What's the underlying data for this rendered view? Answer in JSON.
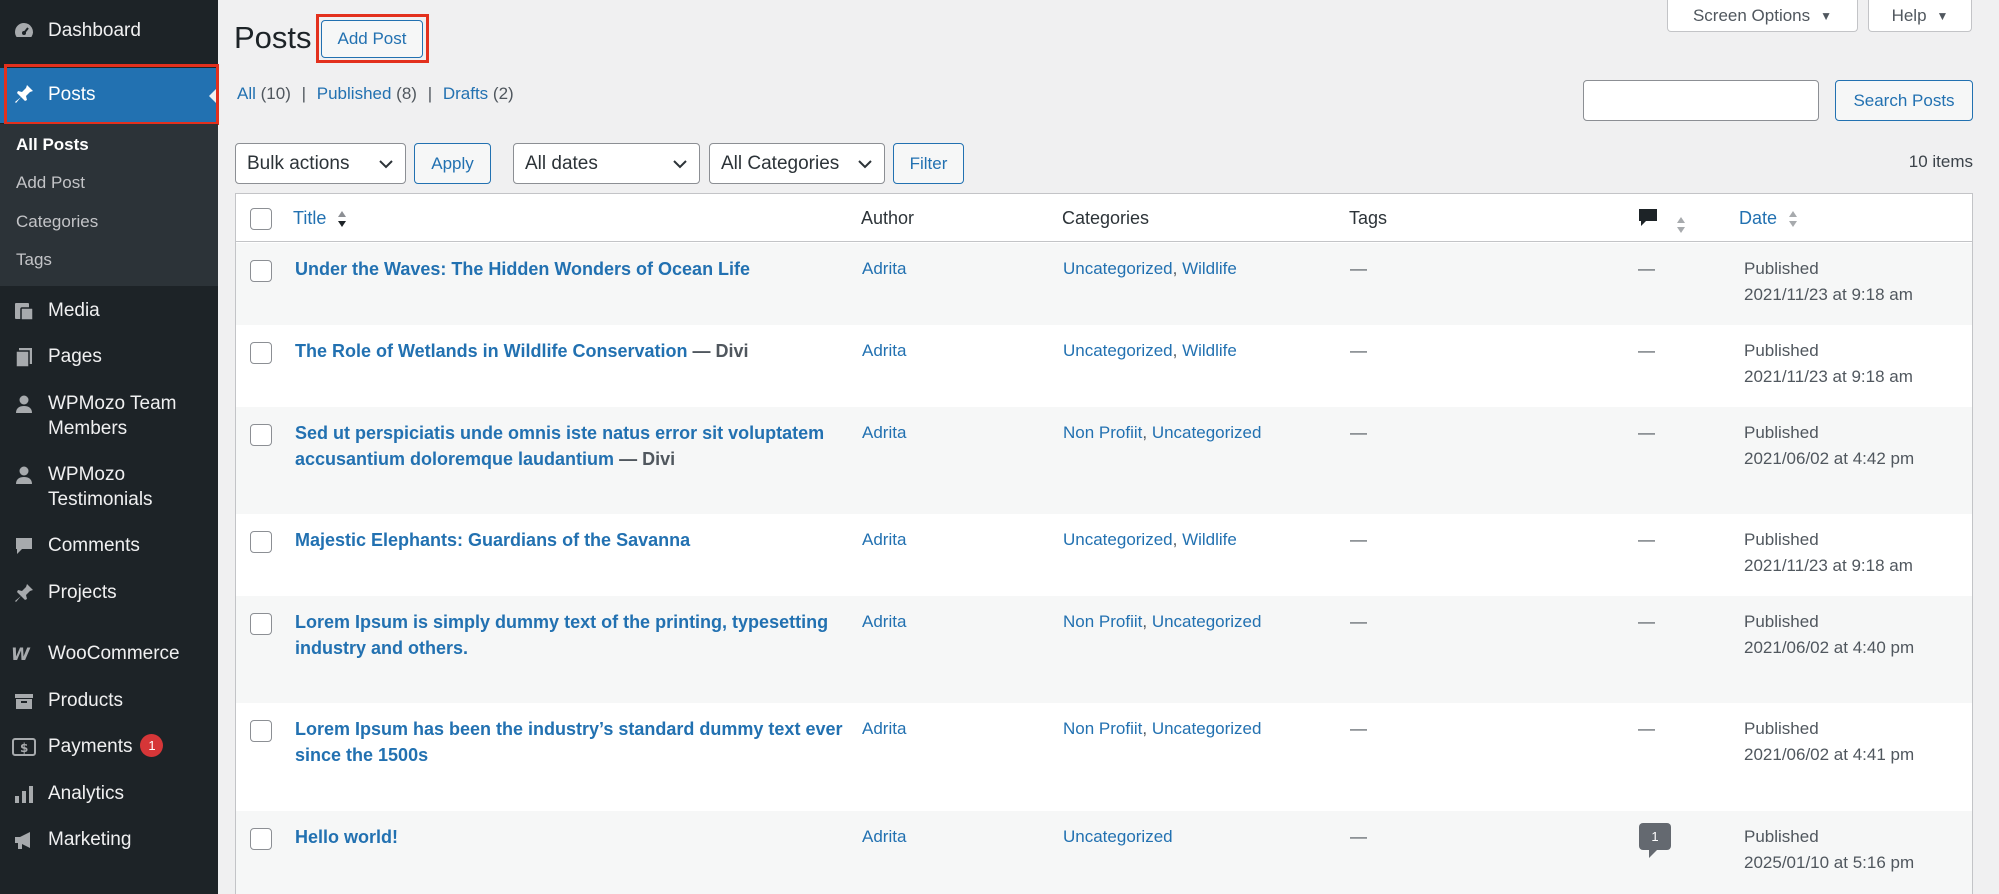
{
  "sidebar": {
    "items": [
      {
        "label": "Dashboard",
        "icon": "dashboard-icon"
      },
      {
        "label": "Posts",
        "icon": "pin-icon"
      },
      {
        "label": "Media",
        "icon": "media-icon"
      },
      {
        "label": "Pages",
        "icon": "pages-icon"
      },
      {
        "label": "WPMozo Team Members",
        "line1": "WPMozo Team",
        "line2": "Members",
        "icon": "user-icon"
      },
      {
        "label": "WPMozo Testimonials",
        "line1": "WPMozo",
        "line2": "Testimonials",
        "icon": "user-icon"
      },
      {
        "label": "Comments",
        "icon": "comment-icon"
      },
      {
        "label": "Projects",
        "icon": "pin-icon"
      },
      {
        "label": "WooCommerce",
        "icon": "woo-icon"
      },
      {
        "label": "Products",
        "icon": "archive-icon"
      },
      {
        "label": "Payments",
        "icon": "money-icon",
        "badge": "1"
      },
      {
        "label": "Analytics",
        "icon": "chart-icon"
      },
      {
        "label": "Marketing",
        "icon": "megaphone-icon"
      }
    ],
    "submenu": [
      "All Posts",
      "Add Post",
      "Categories",
      "Tags"
    ]
  },
  "header": {
    "title": "Posts",
    "add_post": "Add Post",
    "screen_options": "Screen Options",
    "help": "Help"
  },
  "filters_links": {
    "all": "All",
    "all_count": "(10)",
    "published": "Published",
    "published_count": "(8)",
    "drafts": "Drafts",
    "drafts_count": "(2)",
    "sep": "|"
  },
  "search": {
    "value": "",
    "button": "Search Posts"
  },
  "toolbar": {
    "bulk": "Bulk actions",
    "apply": "Apply",
    "dates": "All dates",
    "categories": "All Categories",
    "filter": "Filter",
    "items_count": "10 items"
  },
  "table": {
    "columns": {
      "title": "Title",
      "author": "Author",
      "categories": "Categories",
      "tags": "Tags",
      "date": "Date"
    },
    "rows": [
      {
        "title": "Under the Waves: The Hidden Wonders of Ocean Life",
        "state": "",
        "author": "Adrita",
        "cat1": "Uncategorized",
        "cat2": "Wildlife",
        "tags": "—",
        "comments": "—",
        "status": "Published",
        "date": "2021/11/23 at 9:18 am"
      },
      {
        "title": "The Role of Wetlands in Wildlife Conservation",
        "state": " — Divi",
        "author": "Adrita",
        "cat1": "Uncategorized",
        "cat2": "Wildlife",
        "tags": "—",
        "comments": "—",
        "status": "Published",
        "date": "2021/11/23 at 9:18 am"
      },
      {
        "title": "Sed ut perspiciatis unde omnis iste natus error sit voluptatem accusantium doloremque laudantium",
        "state": " — Divi",
        "author": "Adrita",
        "cat1": "Non Profiit",
        "cat2": "Uncategorized",
        "tags": "—",
        "comments": "—",
        "status": "Published",
        "date": "2021/06/02 at 4:42 pm"
      },
      {
        "title": "Majestic Elephants: Guardians of the Savanna",
        "state": "",
        "author": "Adrita",
        "cat1": "Uncategorized",
        "cat2": "Wildlife",
        "tags": "—",
        "comments": "—",
        "status": "Published",
        "date": "2021/11/23 at 9:18 am"
      },
      {
        "title": "Lorem Ipsum is simply dummy text of the printing, typesetting industry and others.",
        "state": "",
        "author": "Adrita",
        "cat1": "Non Profiit",
        "cat2": "Uncategorized",
        "tags": "—",
        "comments": "—",
        "status": "Published",
        "date": "2021/06/02 at 4:40 pm"
      },
      {
        "title": "Lorem Ipsum has been the industry’s standard dummy text ever since the 1500s",
        "state": "",
        "author": "Adrita",
        "cat1": "Non Profiit",
        "cat2": "Uncategorized",
        "tags": "—",
        "comments": "—",
        "status": "Published",
        "date": "2021/06/02 at 4:41 pm"
      },
      {
        "title": "Hello world!",
        "state": "",
        "author": "Adrita",
        "cat1": "Uncategorized",
        "cat2": "",
        "tags": "—",
        "comments": "1",
        "status": "Published",
        "date": "2025/01/10 at 5:16 pm"
      }
    ]
  },
  "colors": {
    "accent": "#2271b1",
    "sidebar": "#1d2327",
    "highlight": "#e3301d",
    "badge": "#d63638"
  }
}
